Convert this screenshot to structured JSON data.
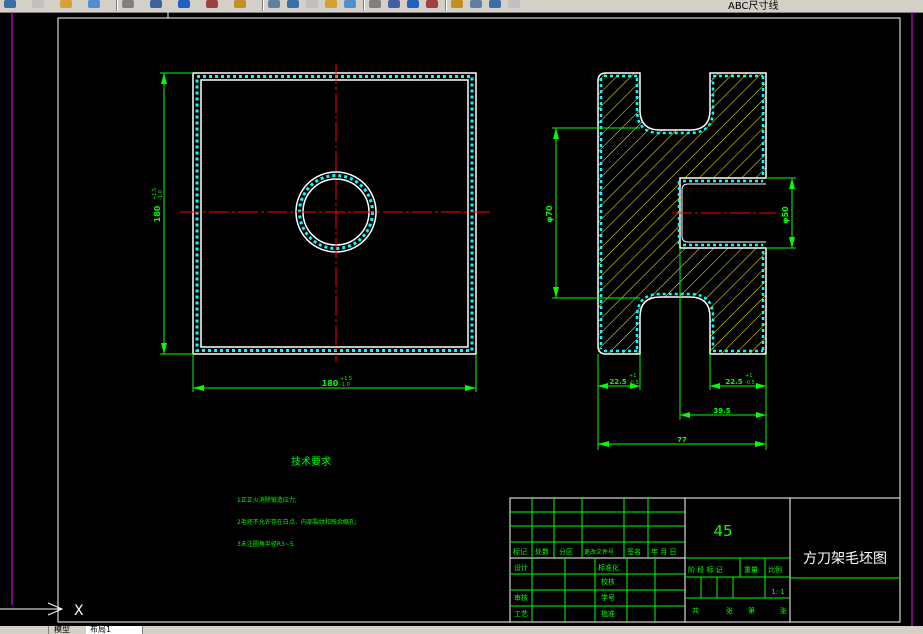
{
  "toolbar": {
    "layer_text": "ABC尺寸线",
    "buttons": [
      "zoom-icon",
      "save-icon",
      "cut-icon",
      "copy-icon",
      "paste-icon",
      "match-icon",
      "undo-icon",
      "redo-icon",
      "pan-icon",
      "zoom-realtime-icon",
      "zoom-window-icon",
      "zoom-previous-icon",
      "text-style-icon",
      "properties-icon",
      "design-center-icon",
      "tool-palette-icon",
      "calculator-icon",
      "help-icon",
      "layers-icon",
      "sun-icon",
      "lock-icon",
      "color-icon"
    ]
  },
  "drawing": {
    "front_view": {
      "height_dim": "180",
      "height_tol_upper": "+1.5",
      "height_tol_lower": "-1.0",
      "width_dim": "180",
      "width_tol_upper": "+1.5",
      "width_tol_lower": "-1.0"
    },
    "side_view": {
      "dim_phi_left": "φ70",
      "dim_phi_right": "φ50",
      "dim_left_flange": "22.5",
      "dim_left_flange_tol_upper": "+1",
      "dim_left_flange_tol_lower": "-0.5",
      "dim_right_flange": "22.5",
      "dim_right_flange_tol_upper": "+1",
      "dim_right_flange_tol_lower": "-0.5",
      "dim_bore_depth": "39.5",
      "dim_total": "77"
    },
    "tech_requirements": {
      "title": "技术要求",
      "items": [
        "1正正火消除锻造应力;",
        "2毛坯不允许存在白点、内部裂纹和残余缩孔;",
        "3未注圆角半径R3~5."
      ]
    },
    "title_block": {
      "material": "45",
      "drawing_name": "方刀架毛坯图",
      "scale": "1: 1",
      "labels": {
        "mark": "标记",
        "count": "处数",
        "zone": "分区",
        "change_doc": "更改文件号",
        "signature": "签名",
        "date": "年 月 日",
        "design": "设计",
        "standardize": "标准化",
        "review": "审核",
        "process": "工艺",
        "proofread": "校核",
        "school_no": "学号",
        "approve": "批准",
        "stage_mark": "阶 段 标 记",
        "weight": "重量",
        "ratio": "比例",
        "total": "共",
        "sheets": "张",
        "sheet_no": "第",
        "sheet_unit": "张"
      }
    }
  },
  "ucs": {
    "x_label": "X"
  },
  "tabs": [
    {
      "label": "",
      "active": false
    },
    {
      "label": "模型",
      "active": false
    },
    {
      "label": "布局1",
      "active": true
    }
  ],
  "colors": {
    "outline": "#ffffff",
    "dim": "#00ff00",
    "hatch": "#ffff00",
    "center": "#ff0000",
    "knurl": "#00ffff",
    "border": "#ff00ff"
  }
}
